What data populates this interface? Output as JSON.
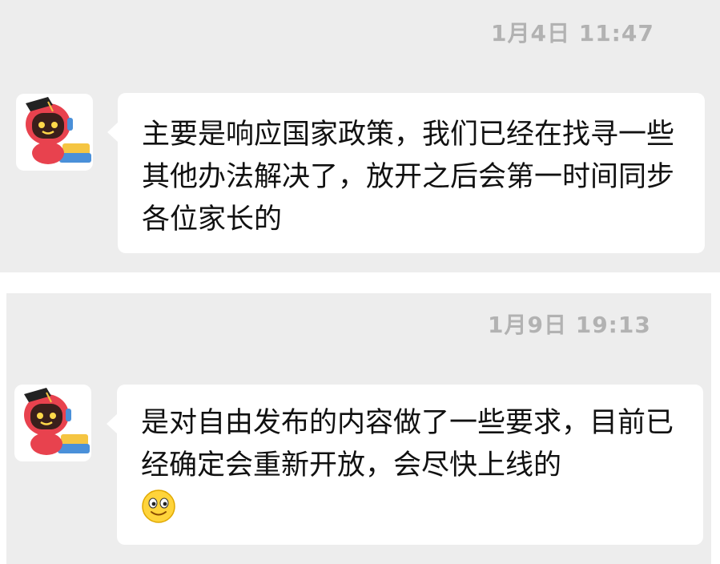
{
  "messages": [
    {
      "timestamp": "1月4日 11:47",
      "sender_avatar": "robot-mascot-avatar",
      "text": "主要是响应国家政策，我们已经在找寻一些其他办法解决了，放开之后会第一时间同步各位家长的"
    },
    {
      "timestamp": "1月9日 19:13",
      "sender_avatar": "robot-mascot-avatar",
      "text": "是对自由发布的内容做了一些要求，目前已经确定会重新开放，会尽快上线的",
      "emoji": "smiley-face-icon"
    }
  ],
  "colors": {
    "background": "#ededed",
    "bubble": "#ffffff",
    "timestamp": "#b2b2b2",
    "text": "#111111",
    "avatar_primary": "#e8424e"
  }
}
